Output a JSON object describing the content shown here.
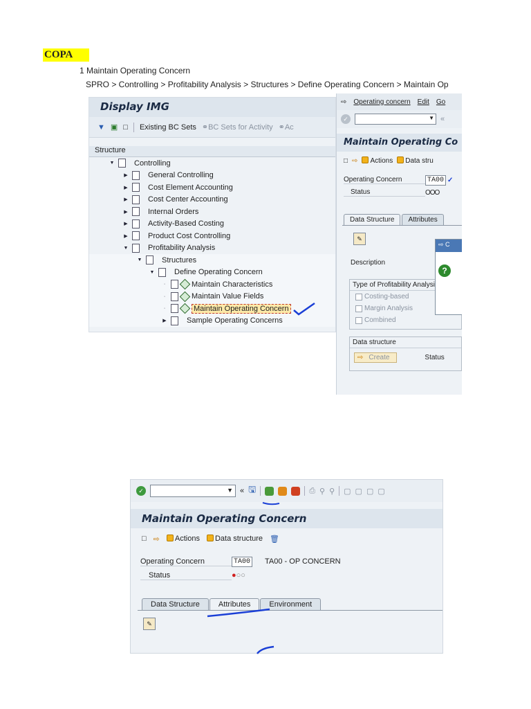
{
  "doc": {
    "title": "COPA",
    "step": "1 Maintain Operating Concern",
    "path": "SPRO > Controlling > Profitability Analysis > Structures > Define Operating Concern > Maintain Op"
  },
  "img_panel": {
    "title": "Display IMG",
    "toolbar": {
      "existing_bc": "Existing BC Sets",
      "bc_activity": "BC Sets for Activity",
      "ac": "Ac"
    },
    "structure_header": "Structure",
    "tree": [
      {
        "label": "Controlling",
        "level": 0,
        "expand": "down"
      },
      {
        "label": "General Controlling",
        "level": 1,
        "expand": "right"
      },
      {
        "label": "Cost Element Accounting",
        "level": 1,
        "expand": "right"
      },
      {
        "label": "Cost Center Accounting",
        "level": 1,
        "expand": "right"
      },
      {
        "label": "Internal Orders",
        "level": 1,
        "expand": "right"
      },
      {
        "label": "Activity-Based Costing",
        "level": 1,
        "expand": "right"
      },
      {
        "label": "Product Cost Controlling",
        "level": 1,
        "expand": "right"
      },
      {
        "label": "Profitability Analysis",
        "level": 1,
        "expand": "down"
      },
      {
        "label": "Structures",
        "level": 2,
        "expand": "down"
      },
      {
        "label": "Define Operating Concern",
        "level": 3,
        "expand": "down"
      },
      {
        "label": "Maintain Characteristics",
        "level": 4,
        "expand": "dot"
      },
      {
        "label": "Maintain Value Fields",
        "level": 4,
        "expand": "dot"
      },
      {
        "label": "Maintain Operating Concern",
        "level": 4,
        "expand": "dot"
      },
      {
        "label": "Sample Operating Concerns",
        "level": 4,
        "expand": "right"
      }
    ]
  },
  "moc_panel": {
    "menu": {
      "operating_concern": "Operating concern",
      "edit": "Edit",
      "go": "Go"
    },
    "title": "Maintain Operating Co",
    "tools": {
      "actions": "Actions",
      "data_struct": "Data stru"
    },
    "operating_concern_label": "Operating Concern",
    "operating_concern_value": "TA00",
    "status_label": "Status",
    "status_value": "OOO",
    "tabs": [
      "Data Structure",
      "Attributes"
    ],
    "popup_header": "C",
    "description_label": "Description",
    "type_group_title": "Type of Profitability Analysis",
    "types": [
      "Costing-based",
      "Margin Analysis",
      "Combined"
    ],
    "data_structure_group": "Data structure",
    "create_label": "Create",
    "status_label_2": "Status"
  },
  "shot2": {
    "title": "Maintain Operating Concern",
    "tools": {
      "actions": "Actions",
      "data_structure": "Data structure"
    },
    "operating_concern_label": "Operating Concern",
    "operating_concern_value": "TA00",
    "operating_concern_desc": "TA00 - OP CONCERN",
    "status_label": "Status",
    "tabs": [
      "Data Structure",
      "Attributes",
      "Environment"
    ]
  }
}
